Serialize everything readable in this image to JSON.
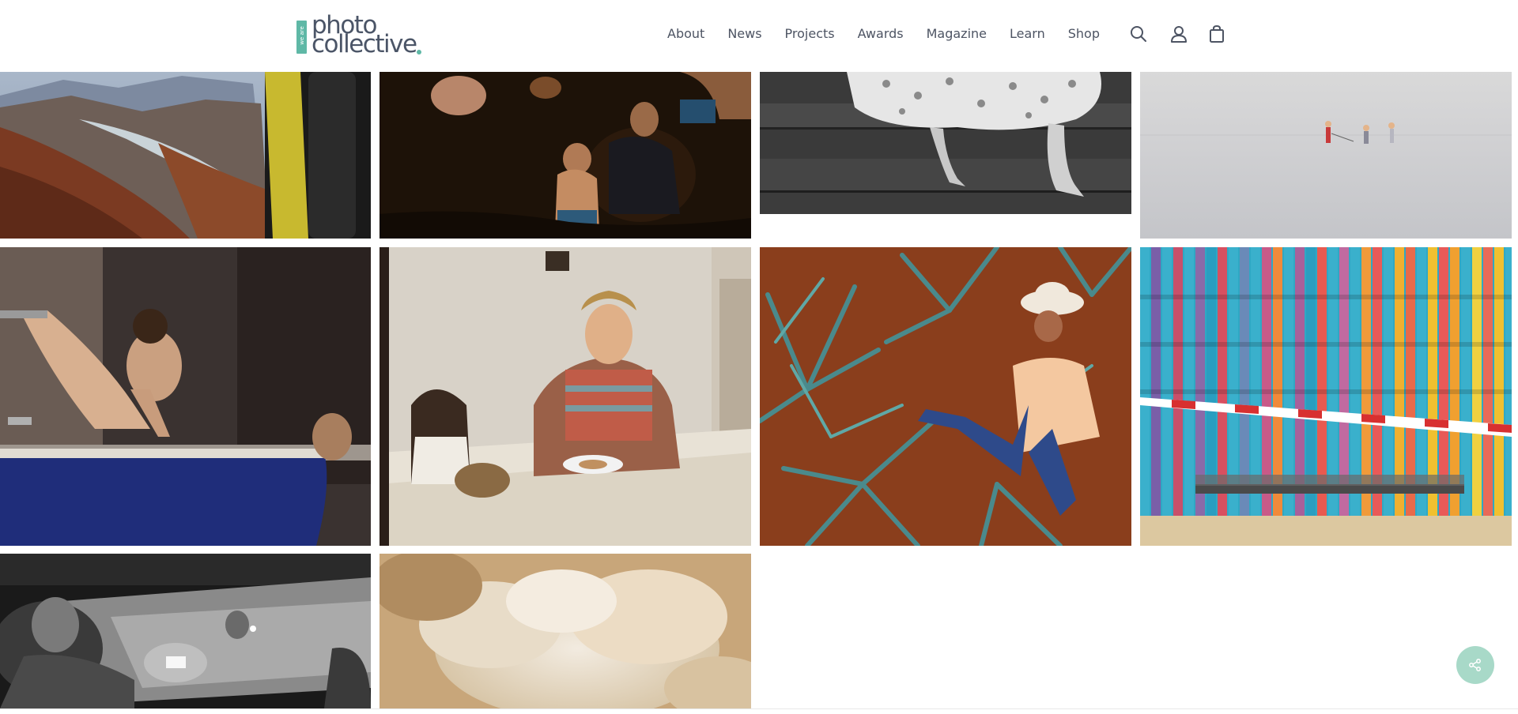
{
  "header": {
    "logo": {
      "vertical_text": "we are",
      "line1": "photo",
      "line2": "collective"
    },
    "nav": [
      {
        "label": "About"
      },
      {
        "label": "News"
      },
      {
        "label": "Projects"
      },
      {
        "label": "Awards"
      },
      {
        "label": "Magazine"
      },
      {
        "label": "Learn"
      },
      {
        "label": "Shop"
      }
    ],
    "icons": [
      "search-icon",
      "account-icon",
      "shopping-bag-icon"
    ]
  },
  "gallery": {
    "photos": [
      {
        "name": "photo-burnt-forest-valley"
      },
      {
        "name": "photo-children-in-dark-water"
      },
      {
        "name": "photo-polka-dot-dress-steps"
      },
      {
        "name": "photo-children-on-calm-sea"
      },
      {
        "name": "photo-child-in-bathtub"
      },
      {
        "name": "photo-mother-daughter-dinner"
      },
      {
        "name": "photo-agave-field-farmer"
      },
      {
        "name": "photo-colorful-bench-wall"
      },
      {
        "name": "photo-workers-night-bw"
      },
      {
        "name": "photo-bushfire-smoke"
      }
    ]
  },
  "share": {
    "icon": "share-icon"
  },
  "colors": {
    "accent": "#5fb8a6",
    "nav_text": "#4d5463",
    "share_button": "#a8d9c8"
  }
}
